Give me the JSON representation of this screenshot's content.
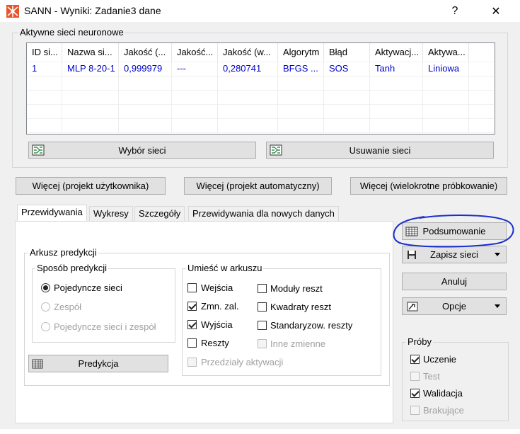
{
  "window": {
    "title": "SANN - Wyniki: Zadanie3 dane",
    "help_label": "?",
    "close_label": "✕"
  },
  "networks": {
    "group_title": "Aktywne sieci neuronowe",
    "columns": [
      "ID si...",
      "Nazwa si...",
      "Jakość (...",
      "Jakość...",
      "Jakość (w...",
      "Algorytm",
      "Błąd",
      "Aktywacj...",
      "Aktywa..."
    ],
    "rows": [
      [
        "1",
        "MLP 8-20-1",
        "0,999979",
        "---",
        "0,280741",
        "BFGS ...",
        "SOS",
        "Tanh",
        "Liniowa"
      ]
    ],
    "select_label": "Wybór sieci",
    "remove_label": "Usuwanie sieci"
  },
  "more_buttons": {
    "user": "Więcej (projekt użytkownika)",
    "auto": "Więcej (projekt automatyczny)",
    "multi": "Więcej (wielokrotne próbkowanie)"
  },
  "tabs": [
    "Przewidywania",
    "Wykresy",
    "Szczegóły",
    "Przewidywania dla nowych danych"
  ],
  "prediction": {
    "group_title": "Arkusz predykcji",
    "method_title": "Sposób predykcji",
    "method_options": [
      {
        "label": "Pojedyncze sieci",
        "checked": true,
        "enabled": true
      },
      {
        "label": "Zespół",
        "checked": false,
        "enabled": false
      },
      {
        "label": "Pojedyncze sieci i zespół",
        "checked": false,
        "enabled": false
      }
    ],
    "place_title": "Umieść w arkuszu",
    "place_left": [
      {
        "label": "Wejścia",
        "checked": false,
        "enabled": true
      },
      {
        "label": "Zmn. zal.",
        "checked": true,
        "enabled": true
      },
      {
        "label": "Wyjścia",
        "checked": true,
        "enabled": true
      },
      {
        "label": "Reszty",
        "checked": false,
        "enabled": true
      }
    ],
    "place_right": [
      {
        "label": "Moduły reszt",
        "checked": false,
        "enabled": true
      },
      {
        "label": "Kwadraty reszt",
        "checked": false,
        "enabled": true
      },
      {
        "label": "Standaryzow. reszty",
        "checked": false,
        "enabled": true
      },
      {
        "label": "Inne zmienne",
        "checked": false,
        "enabled": false
      }
    ],
    "intervals_label": "Przedziały aktywacji",
    "predict_button": "Predykcja"
  },
  "side": {
    "summary": "Podsumowanie",
    "save": "Zapisz sieci",
    "cancel": "Anuluj",
    "options": "Opcje",
    "samples_title": "Próby",
    "samples": [
      {
        "label": "Uczenie",
        "checked": true,
        "enabled": true
      },
      {
        "label": "Test",
        "checked": false,
        "enabled": false
      },
      {
        "label": "Walidacja",
        "checked": true,
        "enabled": true
      },
      {
        "label": "Brakujące",
        "checked": false,
        "enabled": false
      }
    ]
  },
  "colors": {
    "data_text": "#0000cc",
    "annotation_circle": "#1a2fcc"
  }
}
